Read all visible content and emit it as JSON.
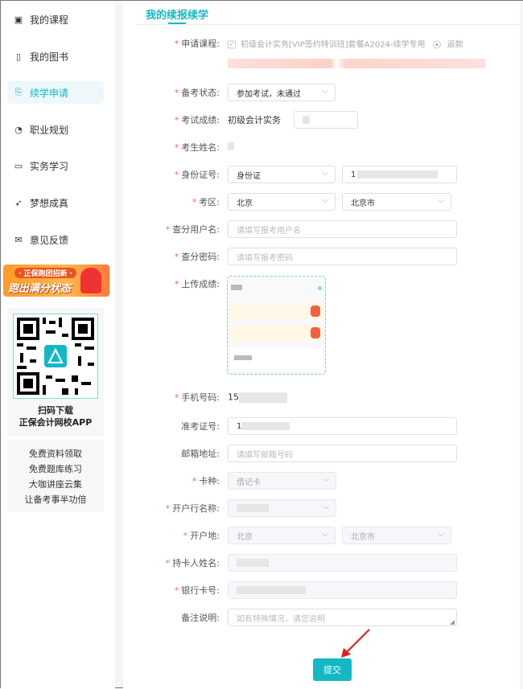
{
  "sidebar": {
    "items": [
      {
        "label": "我的课程",
        "icon": "course-icon"
      },
      {
        "label": "我的图书",
        "icon": "book-icon"
      },
      {
        "label": "续学申请",
        "icon": "apply-icon",
        "active": true
      },
      {
        "label": "职业规划",
        "icon": "career-icon"
      },
      {
        "label": "实务学习",
        "icon": "monitor-icon"
      },
      {
        "label": "梦想成真",
        "icon": "send-icon"
      },
      {
        "label": "意见反馈",
        "icon": "mail-icon"
      }
    ],
    "banner": {
      "line1": "· 正保跑团招新 ·",
      "line2": "跑出满分状态"
    },
    "qr": {
      "line1": "扫码下载",
      "line2": "正保会计网校APP"
    },
    "links": [
      "免费资料领取",
      "免费题库练习",
      "大咖讲座云集",
      "让备考事半功倍"
    ]
  },
  "main": {
    "title": "我的续报续学",
    "form": {
      "course": {
        "label": "申请课程:",
        "value": "初级会计实务[VIP签约特训班]套餐A2024-续学专用",
        "option": "返款"
      },
      "prep_status": {
        "label": "备考状态:",
        "value": "参加考试，未通过"
      },
      "score": {
        "label": "考试成绩:",
        "subject": "初级会计实务"
      },
      "name": {
        "label": "考生姓名:"
      },
      "id": {
        "label": "身份证号:",
        "type": "身份证",
        "value": "1"
      },
      "region": {
        "label": "考区:",
        "province": "北京",
        "city": "北京市"
      },
      "query_user": {
        "label": "查分用户名:",
        "placeholder": "请填写报考用户名"
      },
      "query_pwd": {
        "label": "查分密码:",
        "placeholder": "请填写报考密码"
      },
      "upload": {
        "label": "上传成绩:"
      },
      "phone": {
        "label": "手机号码:",
        "value": "15"
      },
      "ticket": {
        "label": "准考证号:",
        "value": "1"
      },
      "email": {
        "label": "邮箱地址:",
        "placeholder": "请填写邮箱号码"
      },
      "card_type": {
        "label": "卡种:",
        "value": "借记卡"
      },
      "bank_name": {
        "label": "开户行名称:"
      },
      "bank_region": {
        "label": "开户地:",
        "province": "北京",
        "city": "北京市"
      },
      "holder": {
        "label": "持卡人姓名:"
      },
      "card_no": {
        "label": "银行卡号:"
      },
      "remark": {
        "label": "备注说明:",
        "placeholder": "如有特殊情况，请您说明"
      },
      "submit": "提交"
    },
    "colors": {
      "accent": "#14b8c4",
      "required": "#f56c6c",
      "annotation_arrow": "#e02020"
    }
  }
}
